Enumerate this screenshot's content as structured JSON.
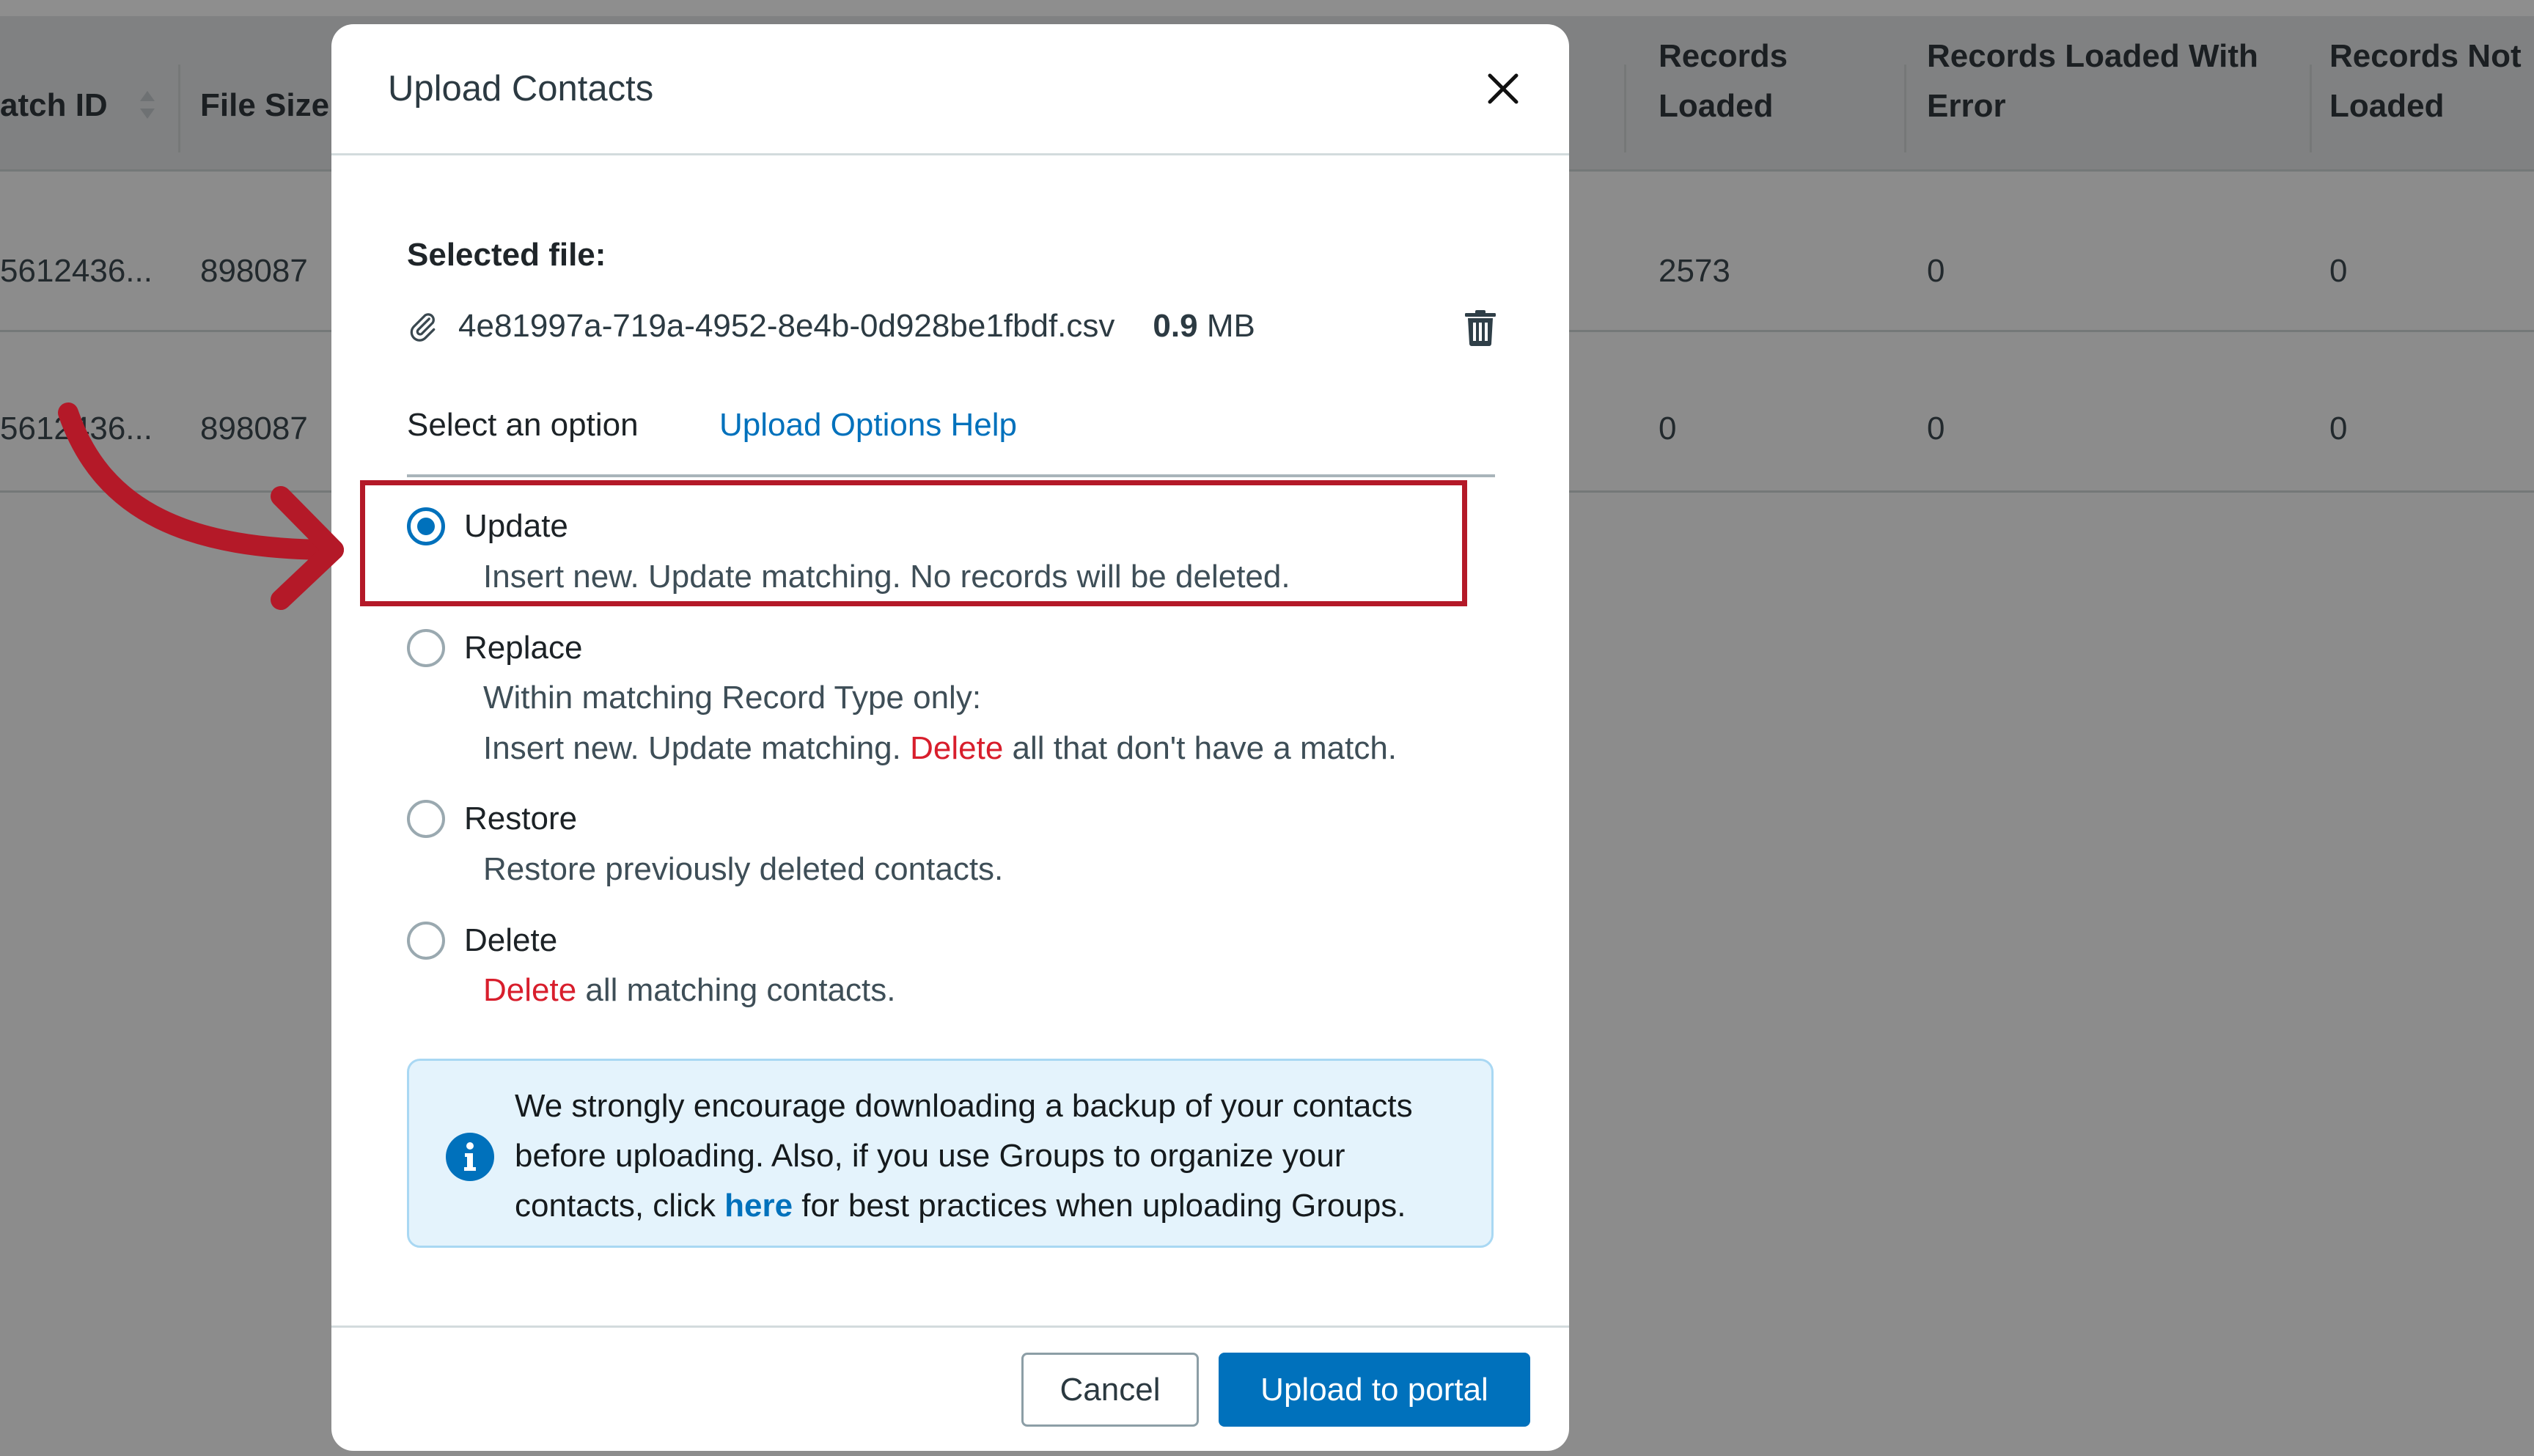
{
  "background_table": {
    "headers": [
      "atch ID",
      "File Size",
      "Records Loaded",
      "Records Loaded With Error",
      "Records Not Loaded"
    ],
    "header_lines": {
      "records_loaded": [
        "Records",
        "Loaded"
      ],
      "records_loaded_with_error": [
        "Records Loaded With",
        "Error"
      ],
      "records_not_loaded": [
        "Records Not",
        "Loaded"
      ]
    },
    "rows": [
      {
        "batch_id": "5612436...",
        "file_size": "898087",
        "records_loaded": "2573",
        "records_loaded_with_error": "0",
        "records_not_loaded": "0"
      },
      {
        "batch_id": "5612436...",
        "file_size": "898087",
        "records_loaded": "0",
        "records_loaded_with_error": "0",
        "records_not_loaded": "0"
      }
    ]
  },
  "modal": {
    "title": "Upload Contacts",
    "close_icon": "close-icon",
    "selected_file_label": "Selected file:",
    "file": {
      "icon": "paperclip-icon",
      "name": "4e81997a-719a-4952-8e4b-0d928be1fbdf.csv",
      "size_value": "0.9",
      "size_unit": "MB",
      "delete_icon": "trash-icon"
    },
    "select_option_label": "Select an option",
    "help_link": "Upload Options Help",
    "options": [
      {
        "label": "Update",
        "selected": true,
        "description": [
          "Insert new. Update matching. No records will be deleted."
        ]
      },
      {
        "label": "Replace",
        "selected": false,
        "description": [
          "Within matching Record Type only:"
        ],
        "description_line2": {
          "before": "Insert new. Update matching. ",
          "danger": "Delete",
          "after": " all that don't have a match."
        }
      },
      {
        "label": "Restore",
        "selected": false,
        "description": [
          "Restore previously deleted contacts."
        ]
      },
      {
        "label": "Delete",
        "selected": false,
        "description_parts": {
          "danger": "Delete",
          "after": " all matching contacts."
        }
      }
    ],
    "info": {
      "icon": "info-icon",
      "text_before": "We strongly encourage downloading a backup of your contacts before uploading. Also, if you use Groups to organize your contacts, click ",
      "link": "here",
      "text_after": " for best practices when uploading Groups."
    },
    "buttons": {
      "cancel": "Cancel",
      "upload": "Upload to portal"
    }
  },
  "colors": {
    "primary": "#0071bc",
    "danger": "#d81e2c",
    "annotation": "#b41928",
    "info_bg": "#e4f3fc"
  }
}
